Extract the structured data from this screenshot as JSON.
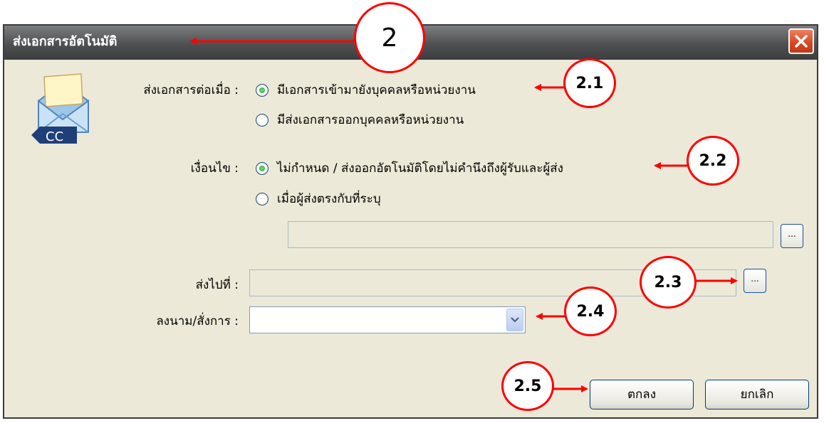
{
  "dialog": {
    "title": "ส่งเอกสารอัตโนมัติ",
    "icon": {
      "name": "envelope-cc-icon",
      "badge": "CC"
    }
  },
  "send_when": {
    "label": "ส่งเอกสารต่อเมื่อ :",
    "options": [
      {
        "label": "มีเอกสารเข้ามายังบุคคลหรือหน่วยงาน",
        "checked": true
      },
      {
        "label": "มีส่งเอกสารออกบุคคลหรือหน่วยงาน",
        "checked": false
      }
    ]
  },
  "condition": {
    "label": "เงื่อนไข :",
    "options": [
      {
        "label": "ไม่กำหนด / ส่งออกอัตโนมัติโดยไม่คำนึงถึงผู้รับและผู้ส่ง",
        "checked": true
      },
      {
        "label": "เมื่อผู้ส่งตรงกับที่ระบุ",
        "checked": false
      }
    ],
    "sender_value": "",
    "browse_label": "..."
  },
  "send_to": {
    "label": "ส่งไปที่ :",
    "value": "",
    "browse_label": "..."
  },
  "sign_order": {
    "label": "ลงนาม/สั่งการ :",
    "value": ""
  },
  "buttons": {
    "ok": "ตกลง",
    "cancel": "ยกเลิก"
  },
  "callouts": [
    "2",
    "2.1",
    "2.2",
    "2.3",
    "2.4",
    "2.5"
  ],
  "colors": {
    "callout_border": "#ff0000",
    "arrow": "#ff0000",
    "titlebar": "#4f5052",
    "dialog_bg": "#ece9d8",
    "radio_checked": "#21a121"
  }
}
